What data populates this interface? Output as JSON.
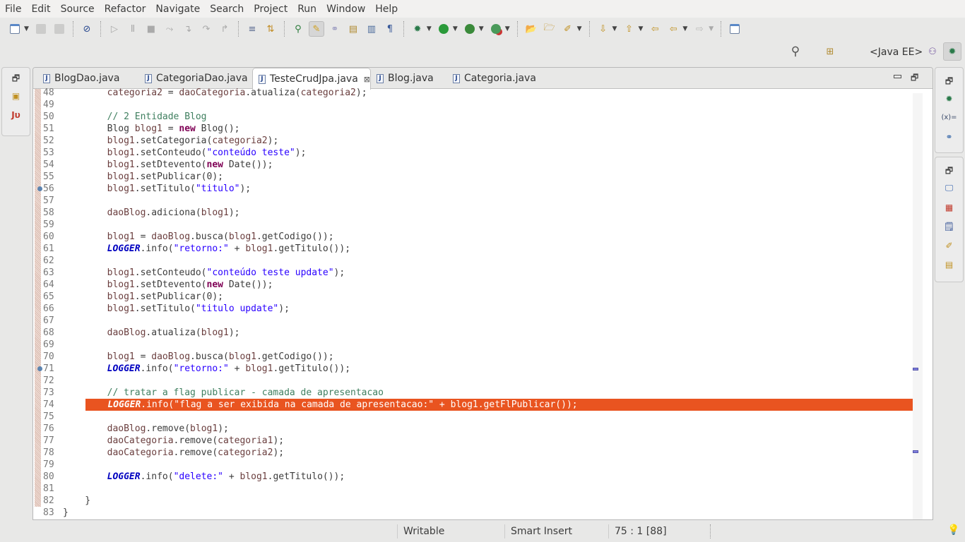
{
  "menu": [
    "File",
    "Edit",
    "Source",
    "Refactor",
    "Navigate",
    "Search",
    "Project",
    "Run",
    "Window",
    "Help"
  ],
  "perspective": {
    "label": "<Java EE>"
  },
  "tabs": [
    {
      "label": "BlogDao.java",
      "active": false
    },
    {
      "label": "CategoriaDao.java",
      "active": false
    },
    {
      "label": "TesteCrudJpa.java",
      "active": true
    },
    {
      "label": "Blog.java",
      "active": false
    },
    {
      "label": "Categoria.java",
      "active": false
    }
  ],
  "left_trim": {
    "junit_label": "Jυ"
  },
  "right_trim": {
    "variables_label": "(x)="
  },
  "code": {
    "highlight_line": 74,
    "breakpoint_lines": [
      56,
      71
    ],
    "lines": [
      {
        "n": "48",
        "t": [
          [
            "p",
            "        "
          ],
          [
            "v",
            "categoria2"
          ],
          [
            "p",
            " = "
          ],
          [
            "v",
            "daoCategoria"
          ],
          [
            "p",
            ".atualiza("
          ],
          [
            "v",
            "categoria2"
          ],
          [
            "p",
            ");"
          ]
        ]
      },
      {
        "n": "49",
        "t": []
      },
      {
        "n": "50",
        "t": [
          [
            "p",
            "        "
          ],
          [
            "c",
            "// 2 Entidade Blog"
          ]
        ]
      },
      {
        "n": "51",
        "t": [
          [
            "p",
            "        Blog "
          ],
          [
            "v",
            "blog1"
          ],
          [
            "p",
            " = "
          ],
          [
            "k",
            "new"
          ],
          [
            "p",
            " Blog();"
          ]
        ]
      },
      {
        "n": "52",
        "t": [
          [
            "p",
            "        "
          ],
          [
            "v",
            "blog1"
          ],
          [
            "p",
            ".setCategoria("
          ],
          [
            "v",
            "categoria2"
          ],
          [
            "p",
            ");"
          ]
        ]
      },
      {
        "n": "53",
        "t": [
          [
            "p",
            "        "
          ],
          [
            "v",
            "blog1"
          ],
          [
            "p",
            ".setConteudo("
          ],
          [
            "s",
            "\"conteúdo teste\""
          ],
          [
            "p",
            ");"
          ]
        ]
      },
      {
        "n": "54",
        "t": [
          [
            "p",
            "        "
          ],
          [
            "v",
            "blog1"
          ],
          [
            "p",
            ".setDtevento("
          ],
          [
            "k",
            "new"
          ],
          [
            "p",
            " Date());"
          ]
        ]
      },
      {
        "n": "55",
        "t": [
          [
            "p",
            "        "
          ],
          [
            "v",
            "blog1"
          ],
          [
            "p",
            ".setPublicar(0);"
          ]
        ]
      },
      {
        "n": "56",
        "t": [
          [
            "p",
            "        "
          ],
          [
            "v",
            "blog1"
          ],
          [
            "p",
            ".setTitulo("
          ],
          [
            "s",
            "\"titulo\""
          ],
          [
            "p",
            ");"
          ]
        ]
      },
      {
        "n": "57",
        "t": []
      },
      {
        "n": "58",
        "t": [
          [
            "p",
            "        "
          ],
          [
            "v",
            "daoBlog"
          ],
          [
            "p",
            ".adiciona("
          ],
          [
            "v",
            "blog1"
          ],
          [
            "p",
            ");"
          ]
        ]
      },
      {
        "n": "59",
        "t": []
      },
      {
        "n": "60",
        "t": [
          [
            "p",
            "        "
          ],
          [
            "v",
            "blog1"
          ],
          [
            "p",
            " = "
          ],
          [
            "v",
            "daoBlog"
          ],
          [
            "p",
            ".busca("
          ],
          [
            "v",
            "blog1"
          ],
          [
            "p",
            ".getCodigo());"
          ]
        ]
      },
      {
        "n": "61",
        "t": [
          [
            "p",
            "        "
          ],
          [
            "f",
            "LOGGER"
          ],
          [
            "p",
            ".info("
          ],
          [
            "s",
            "\"retorno:\""
          ],
          [
            "p",
            " + "
          ],
          [
            "v",
            "blog1"
          ],
          [
            "p",
            ".getTitulo());"
          ]
        ]
      },
      {
        "n": "62",
        "t": []
      },
      {
        "n": "63",
        "t": [
          [
            "p",
            "        "
          ],
          [
            "v",
            "blog1"
          ],
          [
            "p",
            ".setConteudo("
          ],
          [
            "s",
            "\"conteúdo teste update\""
          ],
          [
            "p",
            ");"
          ]
        ]
      },
      {
        "n": "64",
        "t": [
          [
            "p",
            "        "
          ],
          [
            "v",
            "blog1"
          ],
          [
            "p",
            ".setDtevento("
          ],
          [
            "k",
            "new"
          ],
          [
            "p",
            " Date());"
          ]
        ]
      },
      {
        "n": "65",
        "t": [
          [
            "p",
            "        "
          ],
          [
            "v",
            "blog1"
          ],
          [
            "p",
            ".setPublicar(0);"
          ]
        ]
      },
      {
        "n": "66",
        "t": [
          [
            "p",
            "        "
          ],
          [
            "v",
            "blog1"
          ],
          [
            "p",
            ".setTitulo("
          ],
          [
            "s",
            "\"titulo update\""
          ],
          [
            "p",
            ");"
          ]
        ]
      },
      {
        "n": "67",
        "t": []
      },
      {
        "n": "68",
        "t": [
          [
            "p",
            "        "
          ],
          [
            "v",
            "daoBlog"
          ],
          [
            "p",
            ".atualiza("
          ],
          [
            "v",
            "blog1"
          ],
          [
            "p",
            ");"
          ]
        ]
      },
      {
        "n": "69",
        "t": []
      },
      {
        "n": "70",
        "t": [
          [
            "p",
            "        "
          ],
          [
            "v",
            "blog1"
          ],
          [
            "p",
            " = "
          ],
          [
            "v",
            "daoBlog"
          ],
          [
            "p",
            ".busca("
          ],
          [
            "v",
            "blog1"
          ],
          [
            "p",
            ".getCodigo());"
          ]
        ]
      },
      {
        "n": "71",
        "t": [
          [
            "p",
            "        "
          ],
          [
            "f",
            "LOGGER"
          ],
          [
            "p",
            ".info("
          ],
          [
            "s",
            "\"retorno:\""
          ],
          [
            "p",
            " + "
          ],
          [
            "v",
            "blog1"
          ],
          [
            "p",
            ".getTitulo());"
          ]
        ]
      },
      {
        "n": "72",
        "t": []
      },
      {
        "n": "73",
        "t": [
          [
            "p",
            "        "
          ],
          [
            "c",
            "// tratar a flag publicar - camada de apresentacao"
          ]
        ]
      },
      {
        "n": "74",
        "t": [
          [
            "p",
            "    "
          ],
          [
            "f",
            "LOGGER"
          ],
          [
            "p",
            ".info("
          ],
          [
            "s",
            "\"flag a ser exibida na camada de apresentacao:\""
          ],
          [
            "p",
            " + "
          ],
          [
            "v",
            "blog1"
          ],
          [
            "p",
            ".getFlPublicar());"
          ]
        ]
      },
      {
        "n": "75",
        "t": []
      },
      {
        "n": "76",
        "t": [
          [
            "p",
            "        "
          ],
          [
            "v",
            "daoBlog"
          ],
          [
            "p",
            ".remove("
          ],
          [
            "v",
            "blog1"
          ],
          [
            "p",
            ");"
          ]
        ]
      },
      {
        "n": "77",
        "t": [
          [
            "p",
            "        "
          ],
          [
            "v",
            "daoCategoria"
          ],
          [
            "p",
            ".remove("
          ],
          [
            "v",
            "categoria1"
          ],
          [
            "p",
            ");"
          ]
        ]
      },
      {
        "n": "78",
        "t": [
          [
            "p",
            "        "
          ],
          [
            "v",
            "daoCategoria"
          ],
          [
            "p",
            ".remove("
          ],
          [
            "v",
            "categoria2"
          ],
          [
            "p",
            ");"
          ]
        ]
      },
      {
        "n": "79",
        "t": []
      },
      {
        "n": "80",
        "t": [
          [
            "p",
            "        "
          ],
          [
            "f",
            "LOGGER"
          ],
          [
            "p",
            ".info("
          ],
          [
            "s",
            "\"delete:\""
          ],
          [
            "p",
            " + "
          ],
          [
            "v",
            "blog1"
          ],
          [
            "p",
            ".getTitulo());"
          ]
        ]
      },
      {
        "n": "81",
        "t": []
      },
      {
        "n": "82",
        "t": [
          [
            "p",
            "    }"
          ]
        ]
      },
      {
        "n": "83",
        "t": [
          [
            "p",
            "}"
          ]
        ]
      }
    ]
  },
  "status": {
    "writable": "Writable",
    "insert_mode": "Smart Insert",
    "position": "75 : 1 [88]"
  },
  "colors": {
    "highlight": "#e95420",
    "keyword": "#7f0055",
    "string": "#2a00ff",
    "comment": "#3f7f5f",
    "field": "#0000c0",
    "variable": "#6a3e3e"
  }
}
